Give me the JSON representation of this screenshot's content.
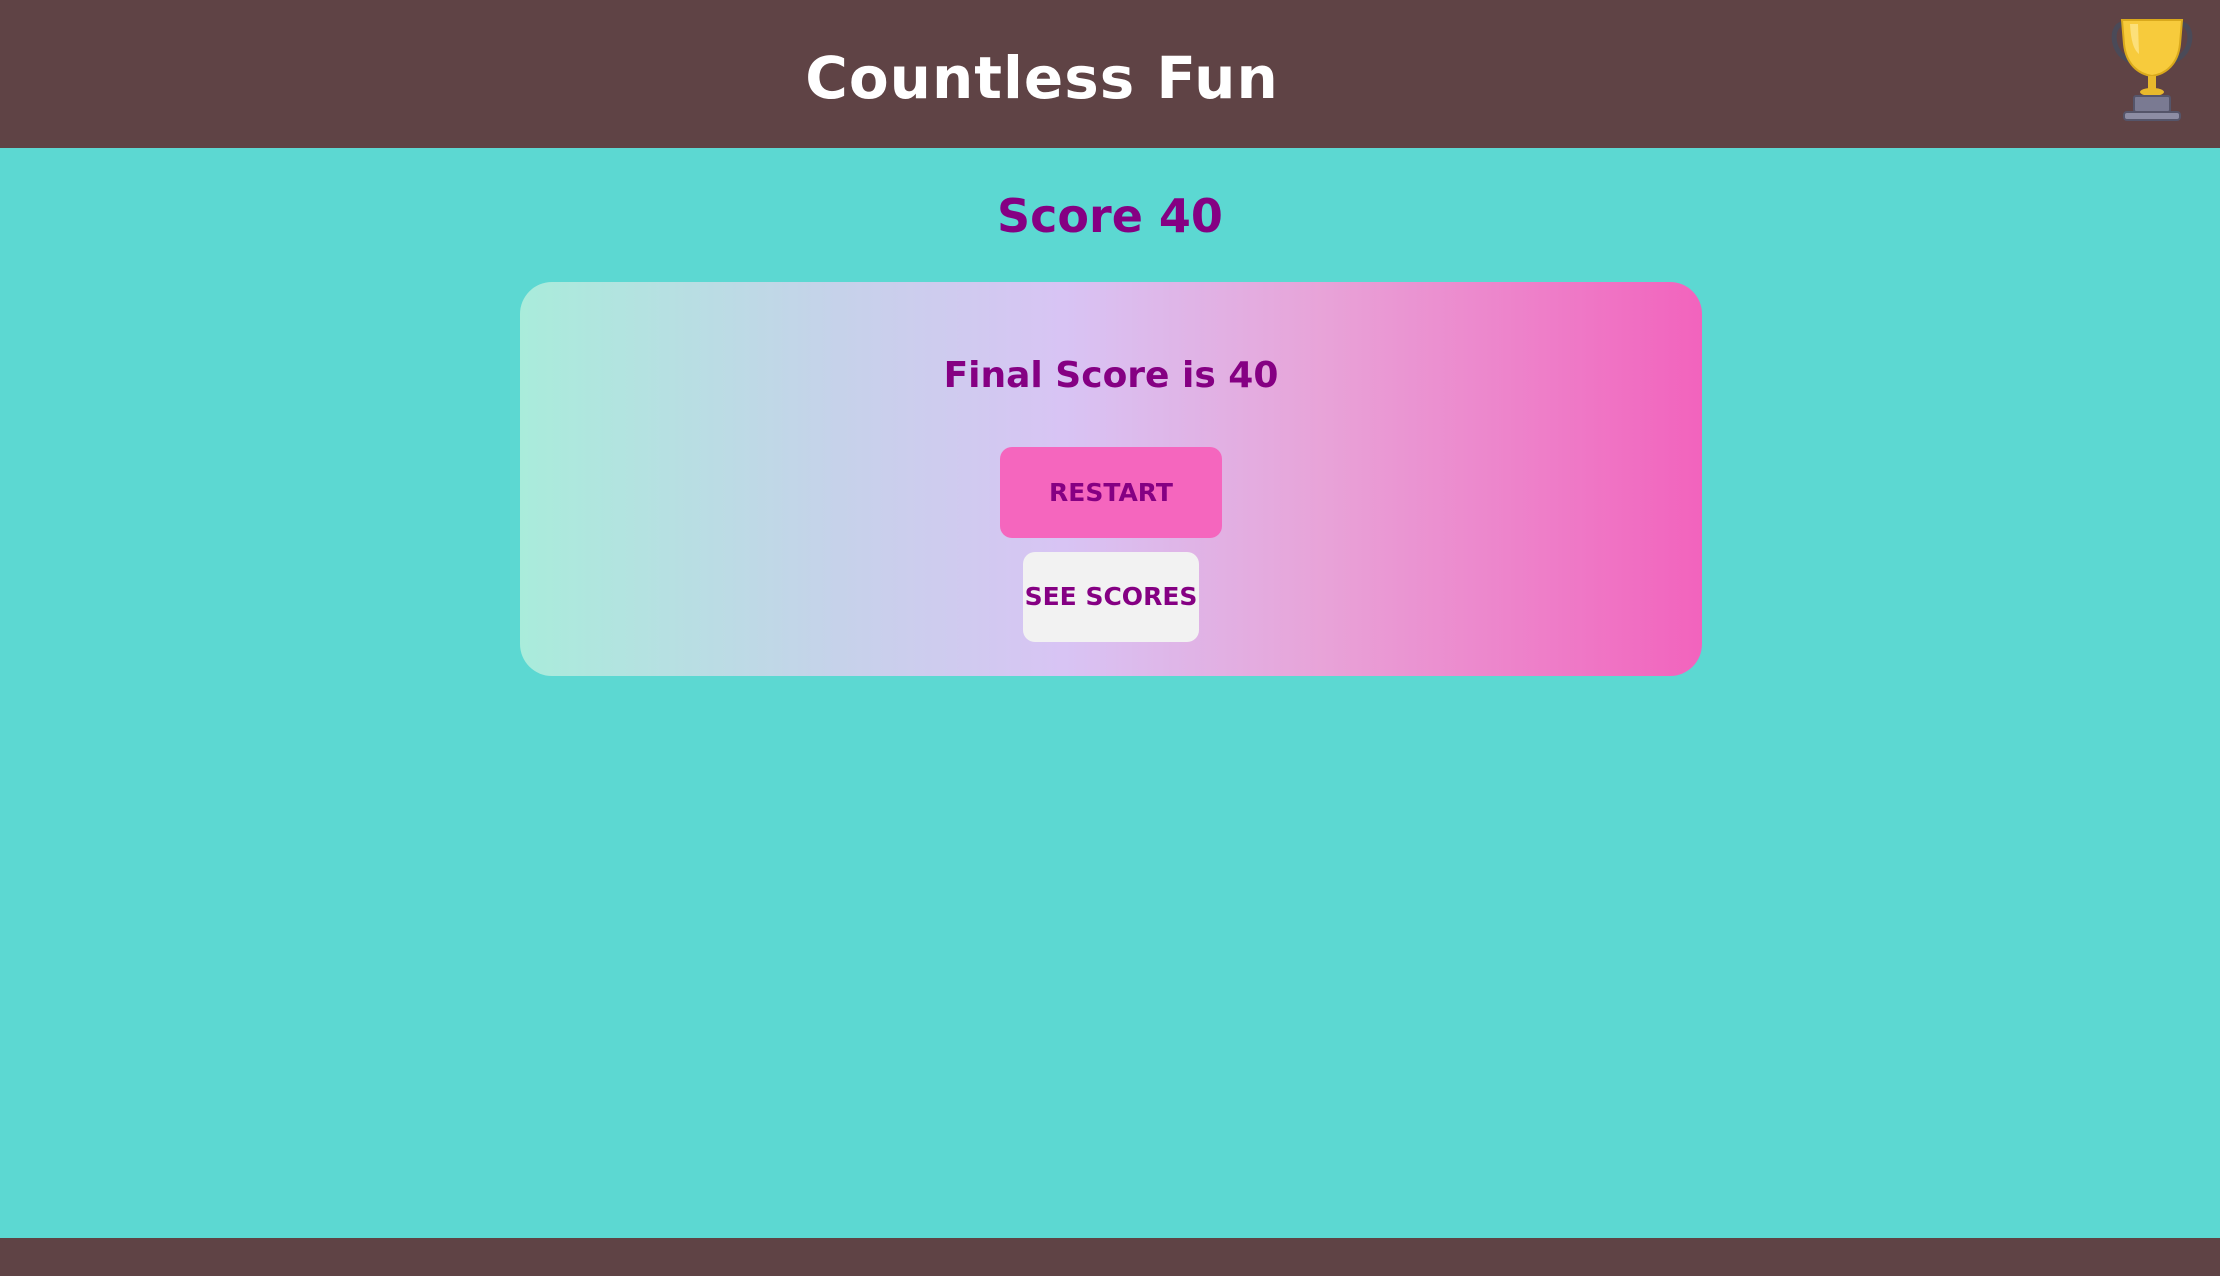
{
  "header": {
    "title": "Countless Fun",
    "trophy_icon": "trophy-icon"
  },
  "score": {
    "label": "Score 40",
    "value": 40
  },
  "result": {
    "final_text": "Final Score is 40",
    "restart_label": "RESTART",
    "see_scores_label": "SEE SCORES"
  },
  "colors": {
    "header_bg": "#5f4345",
    "page_bg": "#5cd8d2",
    "text_purple": "#850083",
    "restart_bg": "#f566be",
    "see_scores_bg": "#f2f2f2",
    "trophy_gold": "#f7cb3c"
  }
}
